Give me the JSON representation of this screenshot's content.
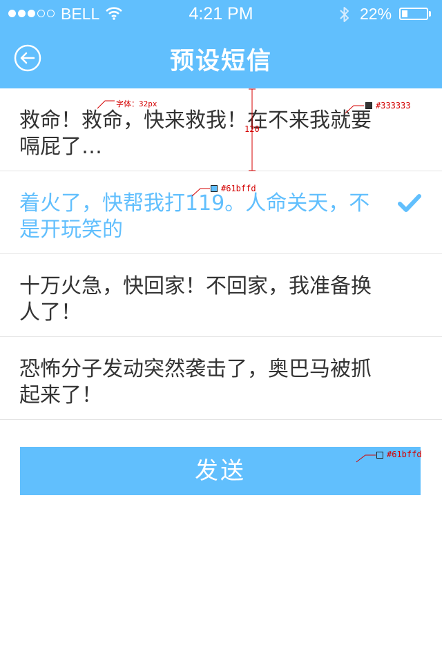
{
  "status_bar": {
    "carrier": "BELL",
    "time": "4:21 PM",
    "battery": "22%",
    "battery_level": 0.22,
    "signal_bars_filled": 3,
    "signal_bars_total": 5
  },
  "nav": {
    "title": "预设短信",
    "back_icon": "back-arrow-circle-icon"
  },
  "messages": [
    {
      "text": "救命！救命，快来救我！在不来我就要嗝屁了…",
      "selected": false
    },
    {
      "text": "着火了，快帮我打119。人命关天，不是开玩笑的",
      "selected": true
    },
    {
      "text": "十万火急，快回家！不回家，我准备换人了！",
      "selected": false
    },
    {
      "text": "恐怖分子发动突然袭击了，奥巴马被抓起来了！",
      "selected": false
    }
  ],
  "send_button": {
    "label": "发送"
  },
  "annotations": {
    "font_note": "字体：32px",
    "color_text": "#333333",
    "color_selected": "#61bffd",
    "color_button": "#61bffd",
    "row_height": "120"
  },
  "colors": {
    "accent": "#61bffd",
    "text": "#333333",
    "divider": "#e4e4e4"
  }
}
